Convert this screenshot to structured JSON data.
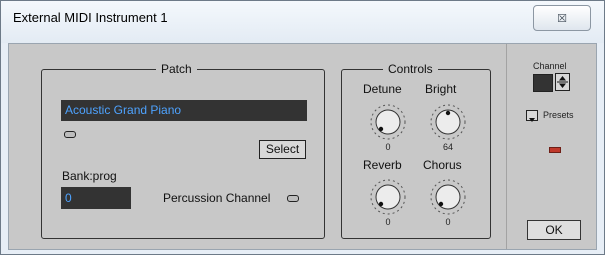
{
  "window": {
    "title": "External MIDI Instrument 1",
    "close_icon": "close-icon",
    "close_glyph": "☒"
  },
  "patch": {
    "legend": "Patch",
    "name": "Acoustic Grand Piano",
    "select_label": "Select",
    "bank_label": "Bank:prog",
    "bank_value": "0",
    "percussion_label": "Percussion Channel"
  },
  "controls": {
    "legend": "Controls",
    "knobs": [
      {
        "label": "Detune",
        "value": "0"
      },
      {
        "label": "Bright",
        "value": "64"
      },
      {
        "label": "Reverb",
        "value": "0"
      },
      {
        "label": "Chorus",
        "value": "0"
      }
    ]
  },
  "side": {
    "channel_label": "Channel",
    "presets_label": "Presets",
    "ok_label": "OK"
  }
}
